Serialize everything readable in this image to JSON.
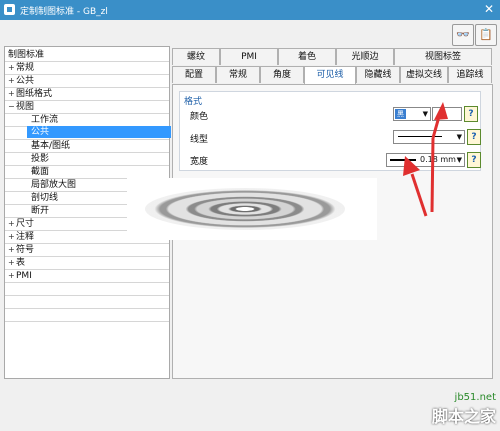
{
  "window": {
    "title": "定制制图标准 - GB_zl"
  },
  "toolbar": {
    "tool1_icon": "view-glasses-icon",
    "tool2_icon": "document-list-icon"
  },
  "tree": {
    "root": "制图标准",
    "items": [
      {
        "label": "常规",
        "expander": "+"
      },
      {
        "label": "公共",
        "expander": "+"
      },
      {
        "label": "图纸格式",
        "expander": "+"
      },
      {
        "label": "视图",
        "expander": "−"
      }
    ],
    "children": [
      {
        "label": "工作流"
      },
      {
        "label": "公共",
        "selected": true
      },
      {
        "label": "基本/图纸"
      },
      {
        "label": "投影"
      },
      {
        "label": "截面"
      },
      {
        "label": "局部放大图"
      },
      {
        "label": "剖切线"
      },
      {
        "label": "断开"
      }
    ],
    "items2": [
      {
        "label": "尺寸",
        "expander": "+"
      },
      {
        "label": "注释",
        "expander": "+"
      },
      {
        "label": "符号",
        "expander": "+"
      },
      {
        "label": "表",
        "expander": "+"
      },
      {
        "label": "PMI",
        "expander": "+"
      }
    ]
  },
  "tabs": {
    "row1": [
      "螺纹",
      "PMI",
      "着色",
      "光顺边",
      "视图标签"
    ],
    "row2": [
      "配置",
      "常规",
      "角度",
      "可见线",
      "隐藏线",
      "虚拟交线",
      "追踪线"
    ],
    "active": "可见线"
  },
  "format": {
    "title": "格式",
    "color_label": "颜色",
    "color_value": "黑",
    "linetype_label": "线型",
    "width_label": "宽度",
    "width_value": "0.18 mm"
  },
  "colors": {
    "titlebar": "#3a8fc8",
    "selected": "#3399ff",
    "arrow": "#e03030"
  },
  "watermark": {
    "url": "jb51.net",
    "name": "脚本之家"
  }
}
